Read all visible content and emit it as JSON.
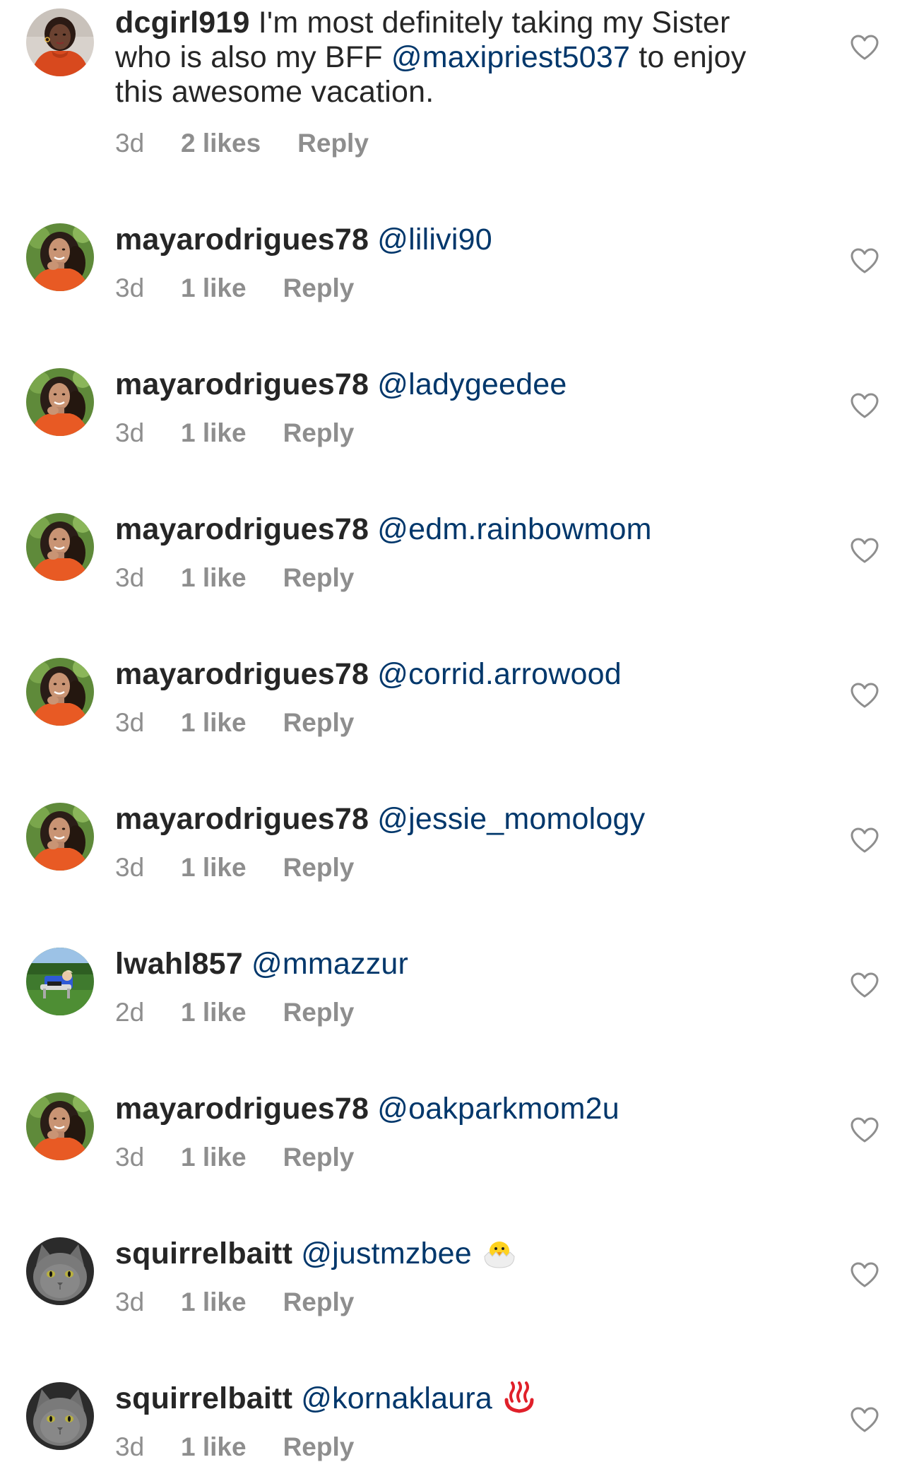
{
  "comments": [
    {
      "username": "dcgirl919",
      "text_before": " I'm most definitely taking my Sister who is also my BFF ",
      "mention": "@maxipriest5037",
      "text_after": "  to enjoy this awesome vacation.",
      "time": "3d",
      "likes": "2 likes",
      "reply": "Reply",
      "avatar": "woman-orange-top",
      "icon": "heart-outline-icon"
    },
    {
      "username": "mayarodrigues78",
      "mention": "@lilivi90",
      "time": "3d",
      "likes": "1 like",
      "reply": "Reply",
      "avatar": "woman-curly-hair"
    },
    {
      "username": "mayarodrigues78",
      "mention": "@ladygeedee",
      "time": "3d",
      "likes": "1 like",
      "reply": "Reply",
      "avatar": "woman-curly-hair"
    },
    {
      "username": "mayarodrigues78",
      "mention": "@edm.rainbowmom",
      "time": "3d",
      "likes": "1 like",
      "reply": "Reply",
      "avatar": "woman-curly-hair"
    },
    {
      "username": "mayarodrigues78",
      "mention": "@corrid.arrowood",
      "time": "3d",
      "likes": "1 like",
      "reply": "Reply",
      "avatar": "woman-curly-hair"
    },
    {
      "username": "mayarodrigues78",
      "mention": "@jessie_momology",
      "time": "3d",
      "likes": "1 like",
      "reply": "Reply",
      "avatar": "woman-curly-hair"
    },
    {
      "username": "lwahl857",
      "mention": "@mmazzur",
      "time": "2d",
      "likes": "1 like",
      "reply": "Reply",
      "avatar": "person-on-lawn"
    },
    {
      "username": "mayarodrigues78",
      "mention": "@oakparkmom2u",
      "time": "3d",
      "likes": "1 like",
      "reply": "Reply",
      "avatar": "woman-curly-hair"
    },
    {
      "username": "squirrelbaitt",
      "mention": "@justmzbee",
      "time": "3d",
      "likes": "1 like",
      "reply": "Reply",
      "avatar": "gray-cat",
      "emoji": "hatching-chick"
    },
    {
      "username": "squirrelbaitt",
      "mention": "@kornaklaura",
      "time": "3d",
      "likes": "1 like",
      "reply": "Reply",
      "avatar": "gray-cat",
      "emoji": "hot-springs"
    }
  ],
  "colors": {
    "text": "#262626",
    "mention": "#00376b",
    "meta": "#8e8e8e"
  }
}
